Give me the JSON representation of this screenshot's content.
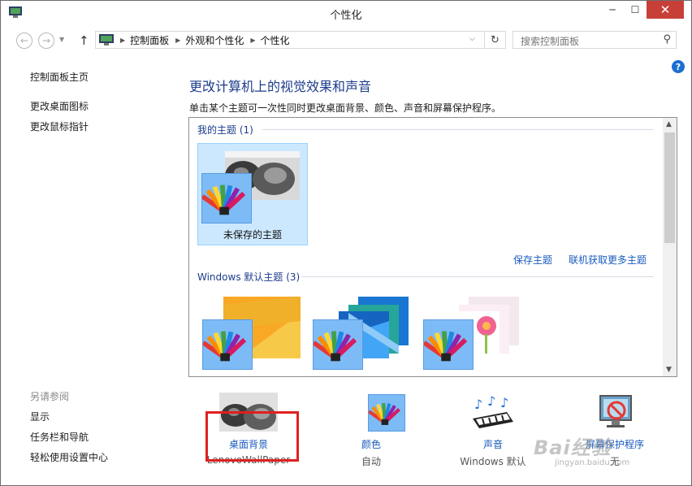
{
  "window": {
    "title": "个性化"
  },
  "address_bar": {
    "crumbs": [
      "控制面板",
      "外观和个性化",
      "个性化"
    ]
  },
  "search": {
    "placeholder": "搜索控制面板"
  },
  "left_pane": {
    "home": "控制面板主页",
    "links": [
      "更改桌面图标",
      "更改鼠标指针"
    ],
    "see_also_heading": "另请参阅",
    "see_also": [
      "显示",
      "任务栏和导航",
      "轻松使用设置中心"
    ]
  },
  "main": {
    "title": "更改计算机上的视觉效果和声音",
    "description": "单击某个主题可一次性同时更改桌面背景、颜色、声音和屏幕保护程序。",
    "my_themes_heading": "我的主题 (1)",
    "unsaved_theme_label": "未保存的主题",
    "save_theme_link": "保存主题",
    "get_more_link": "联机获取更多主题",
    "windows_themes_heading": "Windows 默认主题 (3)"
  },
  "bottom": {
    "desktop_background": {
      "label": "桌面背景",
      "sub": "LenovoWallPaper"
    },
    "color": {
      "label": "颜色",
      "sub": "自动"
    },
    "sounds": {
      "label": "声音",
      "sub": "Windows 默认"
    },
    "screensaver": {
      "label": "屏幕保护程序",
      "sub": "无"
    }
  },
  "watermark": {
    "text": "Bai经验",
    "sub": "jingyan.baidu.com"
  },
  "colors": {
    "accent_link": "#1a5bbd",
    "title_blue": "#1c3c8c",
    "selection": "#cce8ff",
    "close_red": "#c74038",
    "highlight_red": "#e02020"
  }
}
